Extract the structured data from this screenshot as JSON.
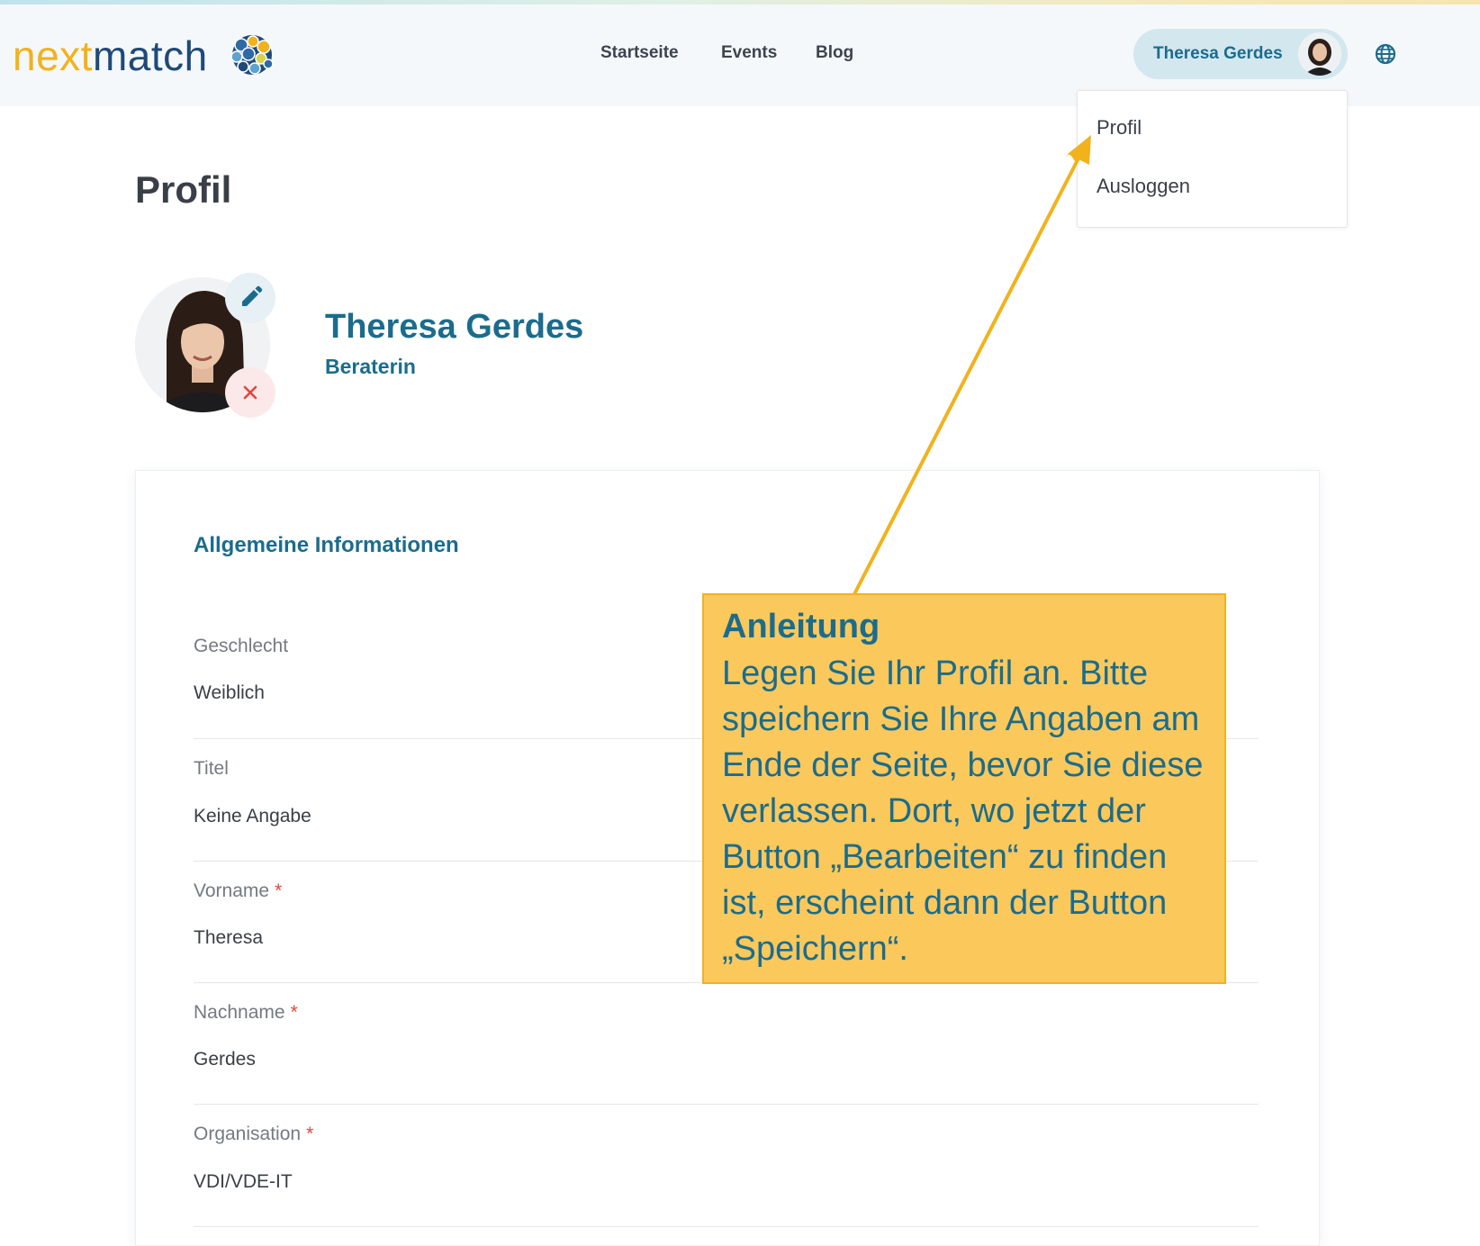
{
  "brand": {
    "logo_part1": "next",
    "logo_part2": "match"
  },
  "nav": {
    "items": [
      "Startseite",
      "Events",
      "Blog"
    ]
  },
  "user_menu": {
    "name": "Theresa Gerdes",
    "dropdown": [
      "Profil",
      "Ausloggen"
    ]
  },
  "page": {
    "title": "Profil"
  },
  "profile": {
    "name": "Theresa Gerdes",
    "role": "Beraterin"
  },
  "general_info": {
    "section_title": "Allgemeine Informationen",
    "fields": [
      {
        "label": "Geschlecht",
        "value": "Weiblich",
        "required": false
      },
      {
        "label": "Titel",
        "value": "Keine Angabe",
        "required": false
      },
      {
        "label": "Vorname",
        "value": "Theresa",
        "required": true
      },
      {
        "label": "Nachname",
        "value": "Gerdes",
        "required": true
      },
      {
        "label": "Organisation",
        "value": "VDI/VDE-IT",
        "required": true
      }
    ],
    "required_marker": "*"
  },
  "callout": {
    "title": "Anleitung",
    "text": "Legen Sie Ihr Profil an. Bitte speichern Sie Ihre Angaben am Ende der Seite, bevor Sie diese verlassen. Dort, wo jetzt der Button „Bearbeiten“ zu finden ist, erscheint dann der Button „Speichern“."
  },
  "colors": {
    "primary": "#1b6c8c",
    "logo_yellow": "#f2b21c",
    "logo_blue": "#1f4a78",
    "callout_bg": "#fbc85c",
    "required": "#e0453e"
  },
  "icons": [
    "logo-mark-icon",
    "globe-icon",
    "pencil-icon",
    "close-icon",
    "arrow-annotation"
  ]
}
